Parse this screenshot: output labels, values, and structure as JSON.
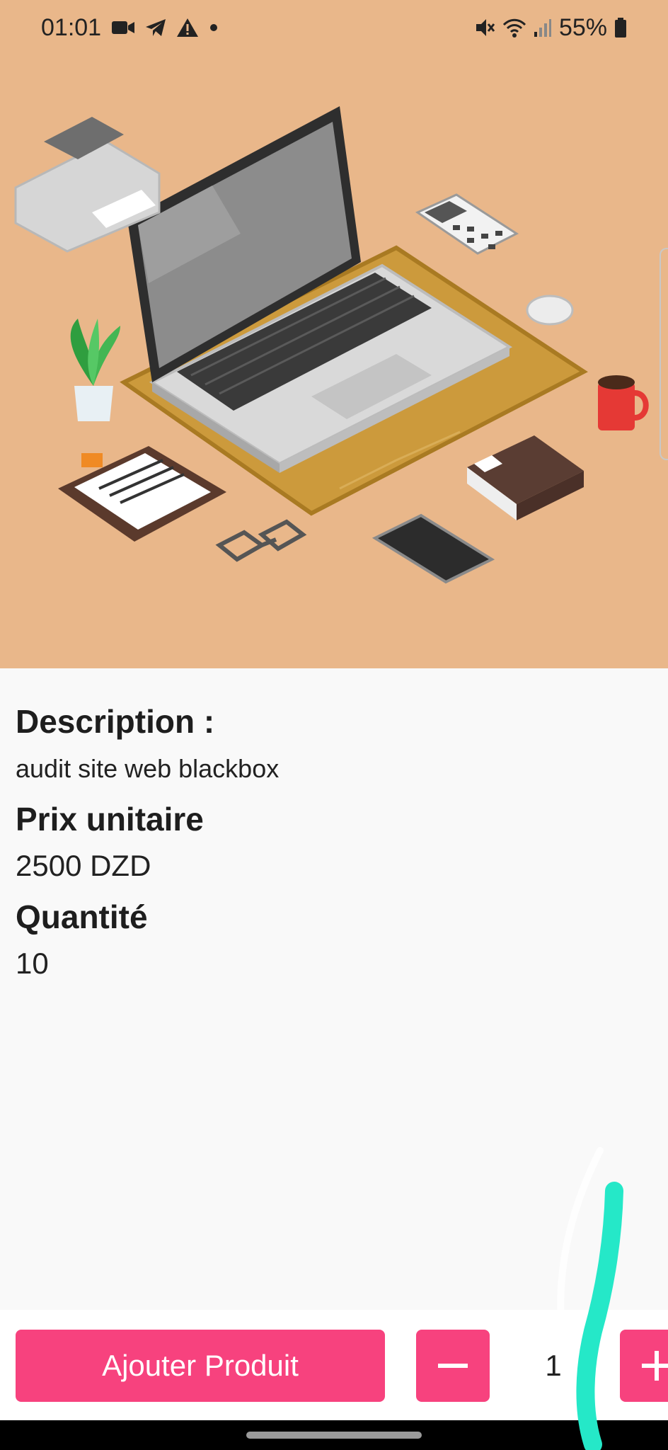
{
  "status_bar": {
    "time": "01:01",
    "battery": "55%",
    "icons_left": [
      "video-camera-icon",
      "telegram-icon",
      "warning-icon",
      "dot-icon"
    ],
    "icons_right": [
      "mute-icon",
      "wifi-icon",
      "signal-icon",
      "battery-icon"
    ]
  },
  "product": {
    "image": "isometric-workspace-illustration",
    "description_label": "Description :",
    "description_value": "audit site web blackbox",
    "price_label": "Prix unitaire",
    "price_value": "2500 DZD",
    "quantity_label": "Quantité",
    "quantity_value": "10"
  },
  "actions": {
    "add_label": "Ajouter Produit",
    "selected_quantity": "1"
  },
  "colors": {
    "accent": "#f7427e",
    "hero_background": "#e9b78a",
    "annotation": "#25e8c8"
  }
}
